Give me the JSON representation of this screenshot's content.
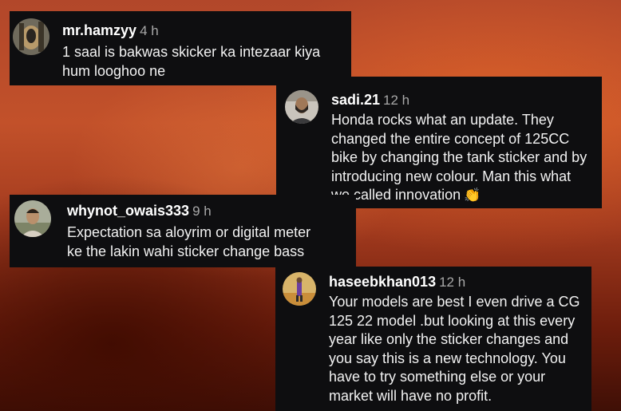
{
  "comments": [
    {
      "username": "mr.hamzyy",
      "time": "4 h",
      "lines": [
        "1 saal is bakwas skicker ka intezaar kiya",
        "hum looghoo ne"
      ],
      "avatar_icon": "profile-photo"
    },
    {
      "username": "sadi.21",
      "time": "12 h",
      "lines": [
        "Honda rocks what an update. They",
        "changed the entire concept of 125CC",
        "bike by changing the tank sticker and by",
        "introducing new colour. Man this what",
        "we called innovation"
      ],
      "emoji": "👏",
      "avatar_icon": "profile-photo"
    },
    {
      "username": "whynot_owais333",
      "time": "9 h",
      "lines": [
        "Expectation sa aloyrim or digital meter",
        "ke the lakin wahi sticker change bass"
      ],
      "avatar_icon": "profile-photo"
    },
    {
      "username": "haseebkhan013",
      "time": "12 h",
      "lines": [
        "Your models are best I even drive a CG",
        "125 22 model .but looking at this every",
        "year like only the sticker changes and",
        "you say this is a new technology. You",
        "have to try something else or your",
        "market will have no profit."
      ],
      "avatar_icon": "profile-photo"
    }
  ],
  "colors": {
    "card_background": "#0e0e10",
    "username": "#ffffff",
    "timestamp": "#a8a8a8",
    "body_text": "#f2f2f2"
  }
}
